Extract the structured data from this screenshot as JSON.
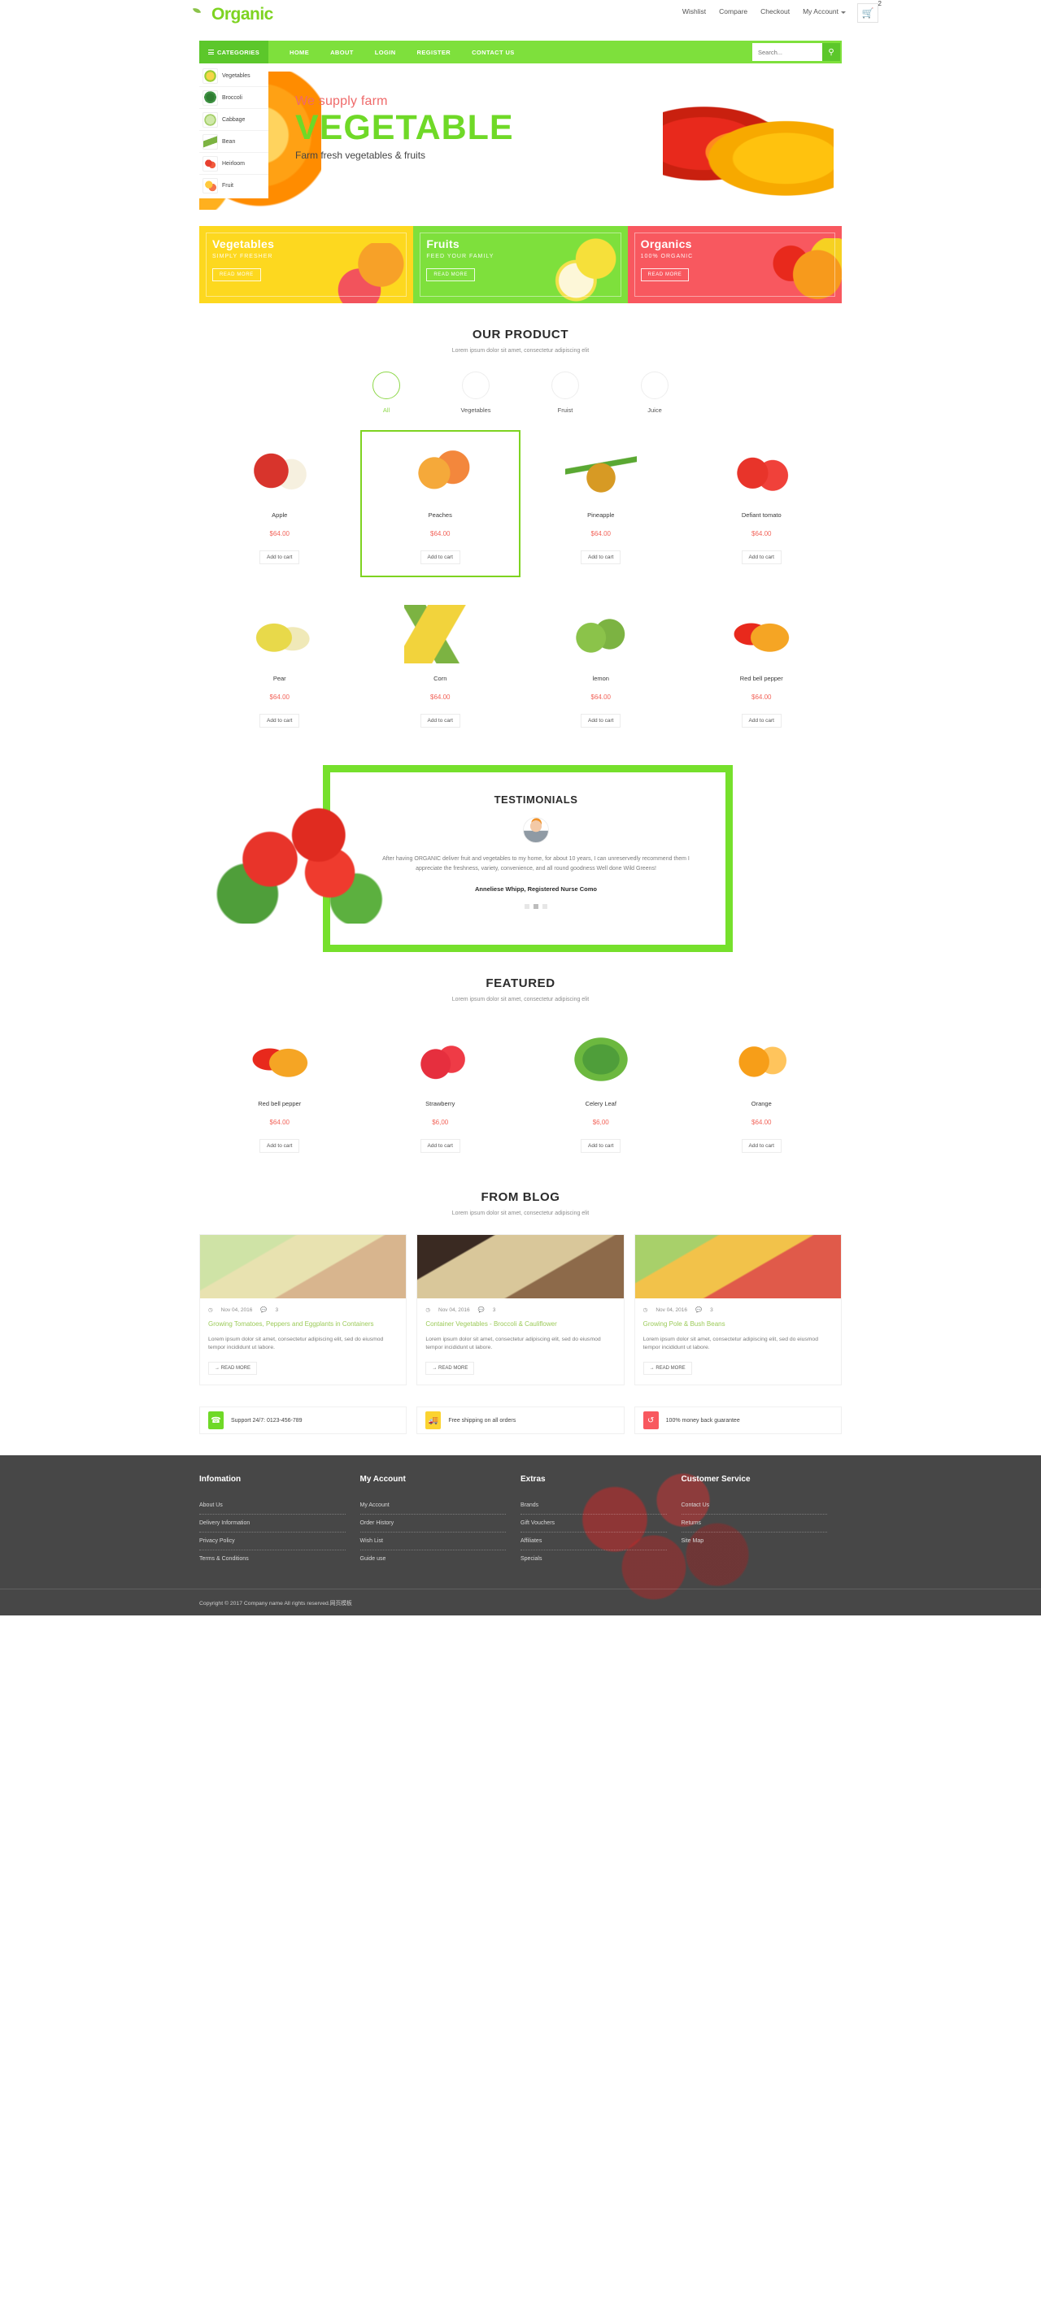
{
  "brand": {
    "name": "Organic"
  },
  "topnav": {
    "links": [
      "Wishlist",
      "Compare",
      "Checkout",
      "My Account"
    ],
    "cart_icon": "cart-icon",
    "cart_count": "2"
  },
  "mainnav": {
    "categories_label": "CATEGORIES",
    "links": [
      "HOME",
      "ABOUT",
      "LOGIN",
      "REGISTER",
      "CONTACT US"
    ],
    "search_placeholder": "Search...",
    "search_icon": "search-icon"
  },
  "categories": [
    {
      "label": "Vegetables",
      "icon": "corn-icon"
    },
    {
      "label": "Broccoli",
      "icon": "broccoli-icon"
    },
    {
      "label": "Cabbage",
      "icon": "cabbage-icon"
    },
    {
      "label": "Bean",
      "icon": "bean-icon"
    },
    {
      "label": "Heirloom",
      "icon": "tomato-icon"
    },
    {
      "label": "Fruit",
      "icon": "fruit-icon"
    }
  ],
  "hero": {
    "line1": "We supply farm",
    "line2": "VEGETABLE",
    "line3": "Farm fresh vegetables & fruits"
  },
  "promos": [
    {
      "title": "Vegetables",
      "subtitle": "SIMPLY FRESHER",
      "button": "READ MORE",
      "color": "#fdd81f"
    },
    {
      "title": "Fruits",
      "subtitle": "FEED YOUR FAMILY",
      "button": "READ MORE",
      "color": "#7ee03c"
    },
    {
      "title": "Organics",
      "subtitle": "100% ORGANIC",
      "button": "READ MORE",
      "color": "#f8585f"
    }
  ],
  "products_section": {
    "title": "OUR PRODUCT",
    "subtitle": "Lorem ipsum dolor sit amet, consectetur adipiscing elit",
    "filters": [
      {
        "label": "All",
        "icon": "corn-icon",
        "active": true
      },
      {
        "label": "Vegetables",
        "icon": "chili-icon",
        "active": false
      },
      {
        "label": "Fruist",
        "icon": "peach-icon",
        "active": false
      },
      {
        "label": "Juice",
        "icon": "berry-icon",
        "active": false
      }
    ],
    "rows": [
      [
        {
          "name": "Apple",
          "price": "$64.00",
          "button": "Add to cart",
          "highlighted": false
        },
        {
          "name": "Peaches",
          "price": "$64.00",
          "button": "Add to cart",
          "highlighted": true
        },
        {
          "name": "Pineapple",
          "price": "$64.00",
          "button": "Add to cart",
          "highlighted": false
        },
        {
          "name": "Defiant tomato",
          "price": "$64.00",
          "button": "Add to cart",
          "highlighted": false
        }
      ],
      [
        {
          "name": "Pear",
          "price": "$64.00",
          "button": "Add to cart",
          "highlighted": false
        },
        {
          "name": "Corn",
          "price": "$64.00",
          "button": "Add to cart",
          "highlighted": false
        },
        {
          "name": "lemon",
          "price": "$64.00",
          "button": "Add to cart",
          "highlighted": false
        },
        {
          "name": "Red bell pepper",
          "price": "$64.00",
          "button": "Add to cart",
          "highlighted": false
        }
      ]
    ]
  },
  "testimonials": {
    "title": "TESTIMONIALS",
    "avatar": "user-avatar",
    "quote": "After having ORGANIC deliver fruit and vegetables to my home, for about 10 years, I can unreservedly recommend them I appreciate the freshness, variety, convenience, and all round goodness Well done Wild Greens!",
    "author": "Anneliese Whipp, Registered Nurse Como",
    "dots": 3,
    "active_dot": 1
  },
  "featured_section": {
    "title": "FEATURED",
    "subtitle": "Lorem ipsum dolor sit amet, consectetur adipiscing elit",
    "items": [
      {
        "name": "Red bell pepper",
        "price": "$64.00",
        "button": "Add to cart"
      },
      {
        "name": "Strawberry",
        "price": "$6,00",
        "button": "Add to cart"
      },
      {
        "name": "Celery Leaf",
        "price": "$6,00",
        "button": "Add to cart"
      },
      {
        "name": "Orange",
        "price": "$64.00",
        "button": "Add to cart"
      }
    ]
  },
  "blog_section": {
    "title": "FROM BLOG",
    "subtitle": "Lorem ipsum dolor sit amet, consectetur adipiscing elit",
    "posts": [
      {
        "date": "Nov 04, 2016",
        "comments": "3",
        "title": "Growing Tomatoes, Peppers and Eggplants in Containers",
        "excerpt": "Lorem ipsum dolor sit amet, consectetur adipiscing elit, sed do eiusmod tempor incididunt ut labore.",
        "button": "READ MORE"
      },
      {
        "date": "Nov 04, 2016",
        "comments": "3",
        "title": "Container Vegetables - Broccoli & Cauliflower",
        "excerpt": "Lorem ipsum dolor sit amet, consectetur adipiscing elit, sed do eiusmod tempor incididunt ut labore.",
        "button": "READ MORE"
      },
      {
        "date": "Nov 04, 2016",
        "comments": "3",
        "title": "Growing Pole & Bush Beans",
        "excerpt": "Lorem ipsum dolor sit amet, consectetur adipiscing elit, sed do eiusmod tempor incididunt ut labore.",
        "button": "READ MORE"
      }
    ]
  },
  "services": [
    {
      "text": "Support 24/7: 0123-456-789",
      "icon": "phone-icon",
      "color": "#6fd927"
    },
    {
      "text": "Free shipping on all orders",
      "icon": "truck-icon",
      "color": "#fbd330"
    },
    {
      "text": "100% money back guarantee",
      "icon": "refresh-icon",
      "color": "#f8585f"
    }
  ],
  "footer": {
    "columns": [
      {
        "heading": "Infomation",
        "links": [
          "About Us",
          "Delivery Information",
          "Privacy Policy",
          "Terms & Conditions"
        ]
      },
      {
        "heading": "My Account",
        "links": [
          "My Account",
          "Order History",
          "Wish List",
          "Guide use"
        ]
      },
      {
        "heading": "Extras",
        "links": [
          "Brands",
          "Gift Vouchers",
          "Affiliates",
          "Specials"
        ]
      },
      {
        "heading": "Customer Service",
        "links": [
          "Contact Us",
          "Returns",
          "Site Map"
        ]
      }
    ],
    "copyright": "Copyright © 2017 Company name All rights reserved.网页模板"
  }
}
